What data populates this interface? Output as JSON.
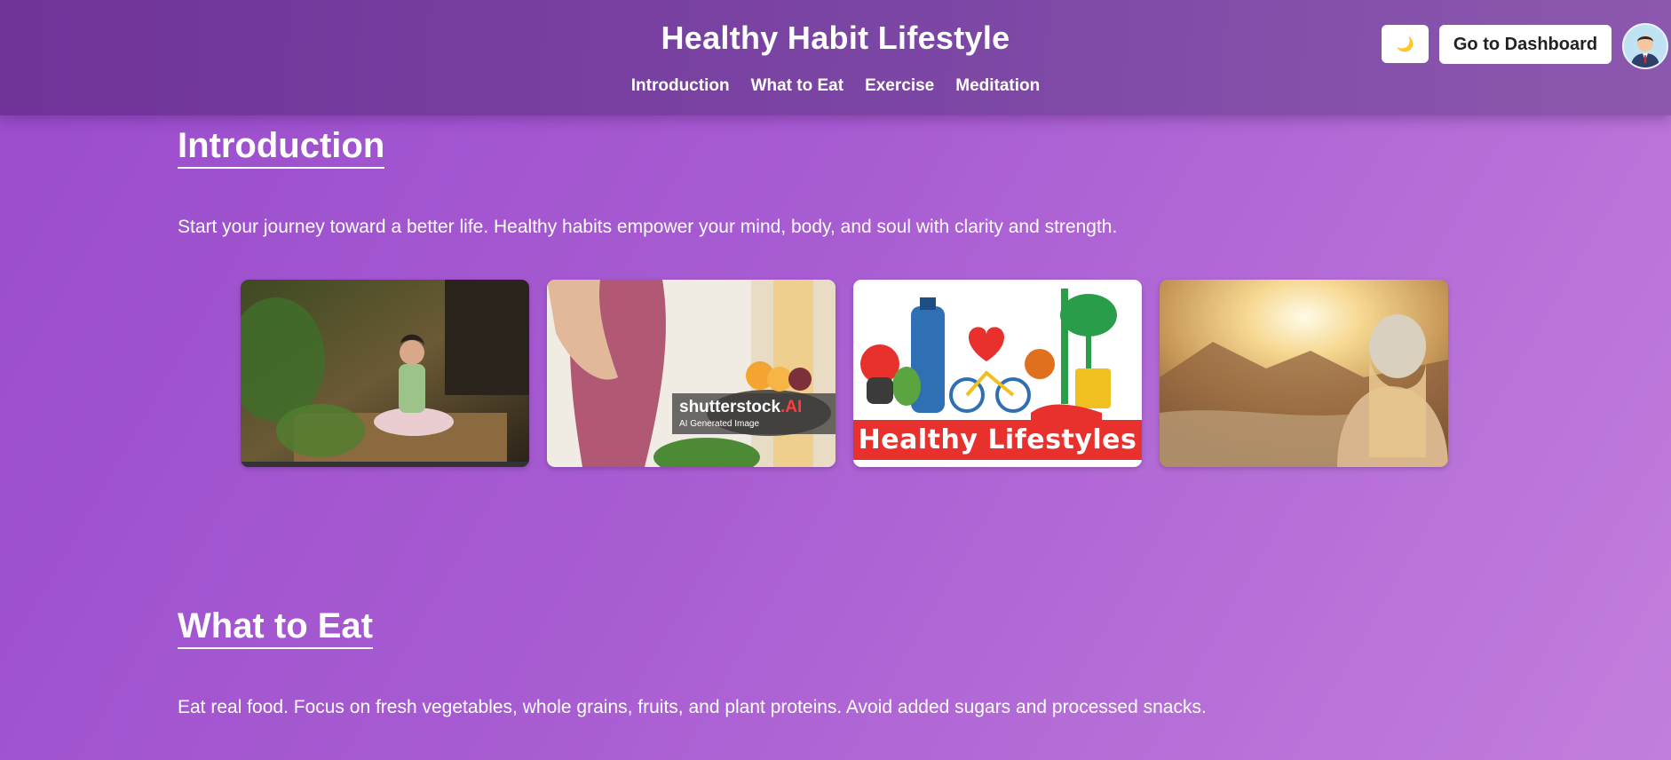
{
  "header": {
    "title": "Healthy Habit Lifestyle",
    "nav": [
      "Introduction",
      "What to Eat",
      "Exercise",
      "Meditation"
    ],
    "theme_toggle_icon": "moon-icon",
    "theme_toggle_glyph": "🌙",
    "dashboard_label": "Go to Dashboard",
    "avatar_icon": "user-avatar-icon"
  },
  "intro": {
    "heading": "Introduction",
    "text": "Start your journey toward a better life. Healthy habits empower your mind, body, and soul with clarity and strength.",
    "images": [
      {
        "name": "meditation-photo"
      },
      {
        "name": "fruit-bowl-photo",
        "watermark_brand": "shutterstock",
        "watermark_suffix": ".AI",
        "watermark_sub": "AI Generated Image"
      },
      {
        "name": "healthy-lifestyles-illustration",
        "banner": "Healthy Lifestyles"
      },
      {
        "name": "sunset-freedom-photo"
      }
    ]
  },
  "eat": {
    "heading": "What to Eat",
    "text": "Eat real food. Focus on fresh vegetables, whole grains, fruits, and plant proteins. Avoid added sugars and processed snacks."
  },
  "colors": {
    "header_bg": "#7a3fa6",
    "page_gradient_start": "#9a4ccc",
    "page_gradient_end": "#c27edc",
    "banner_red": "#e8302c"
  }
}
